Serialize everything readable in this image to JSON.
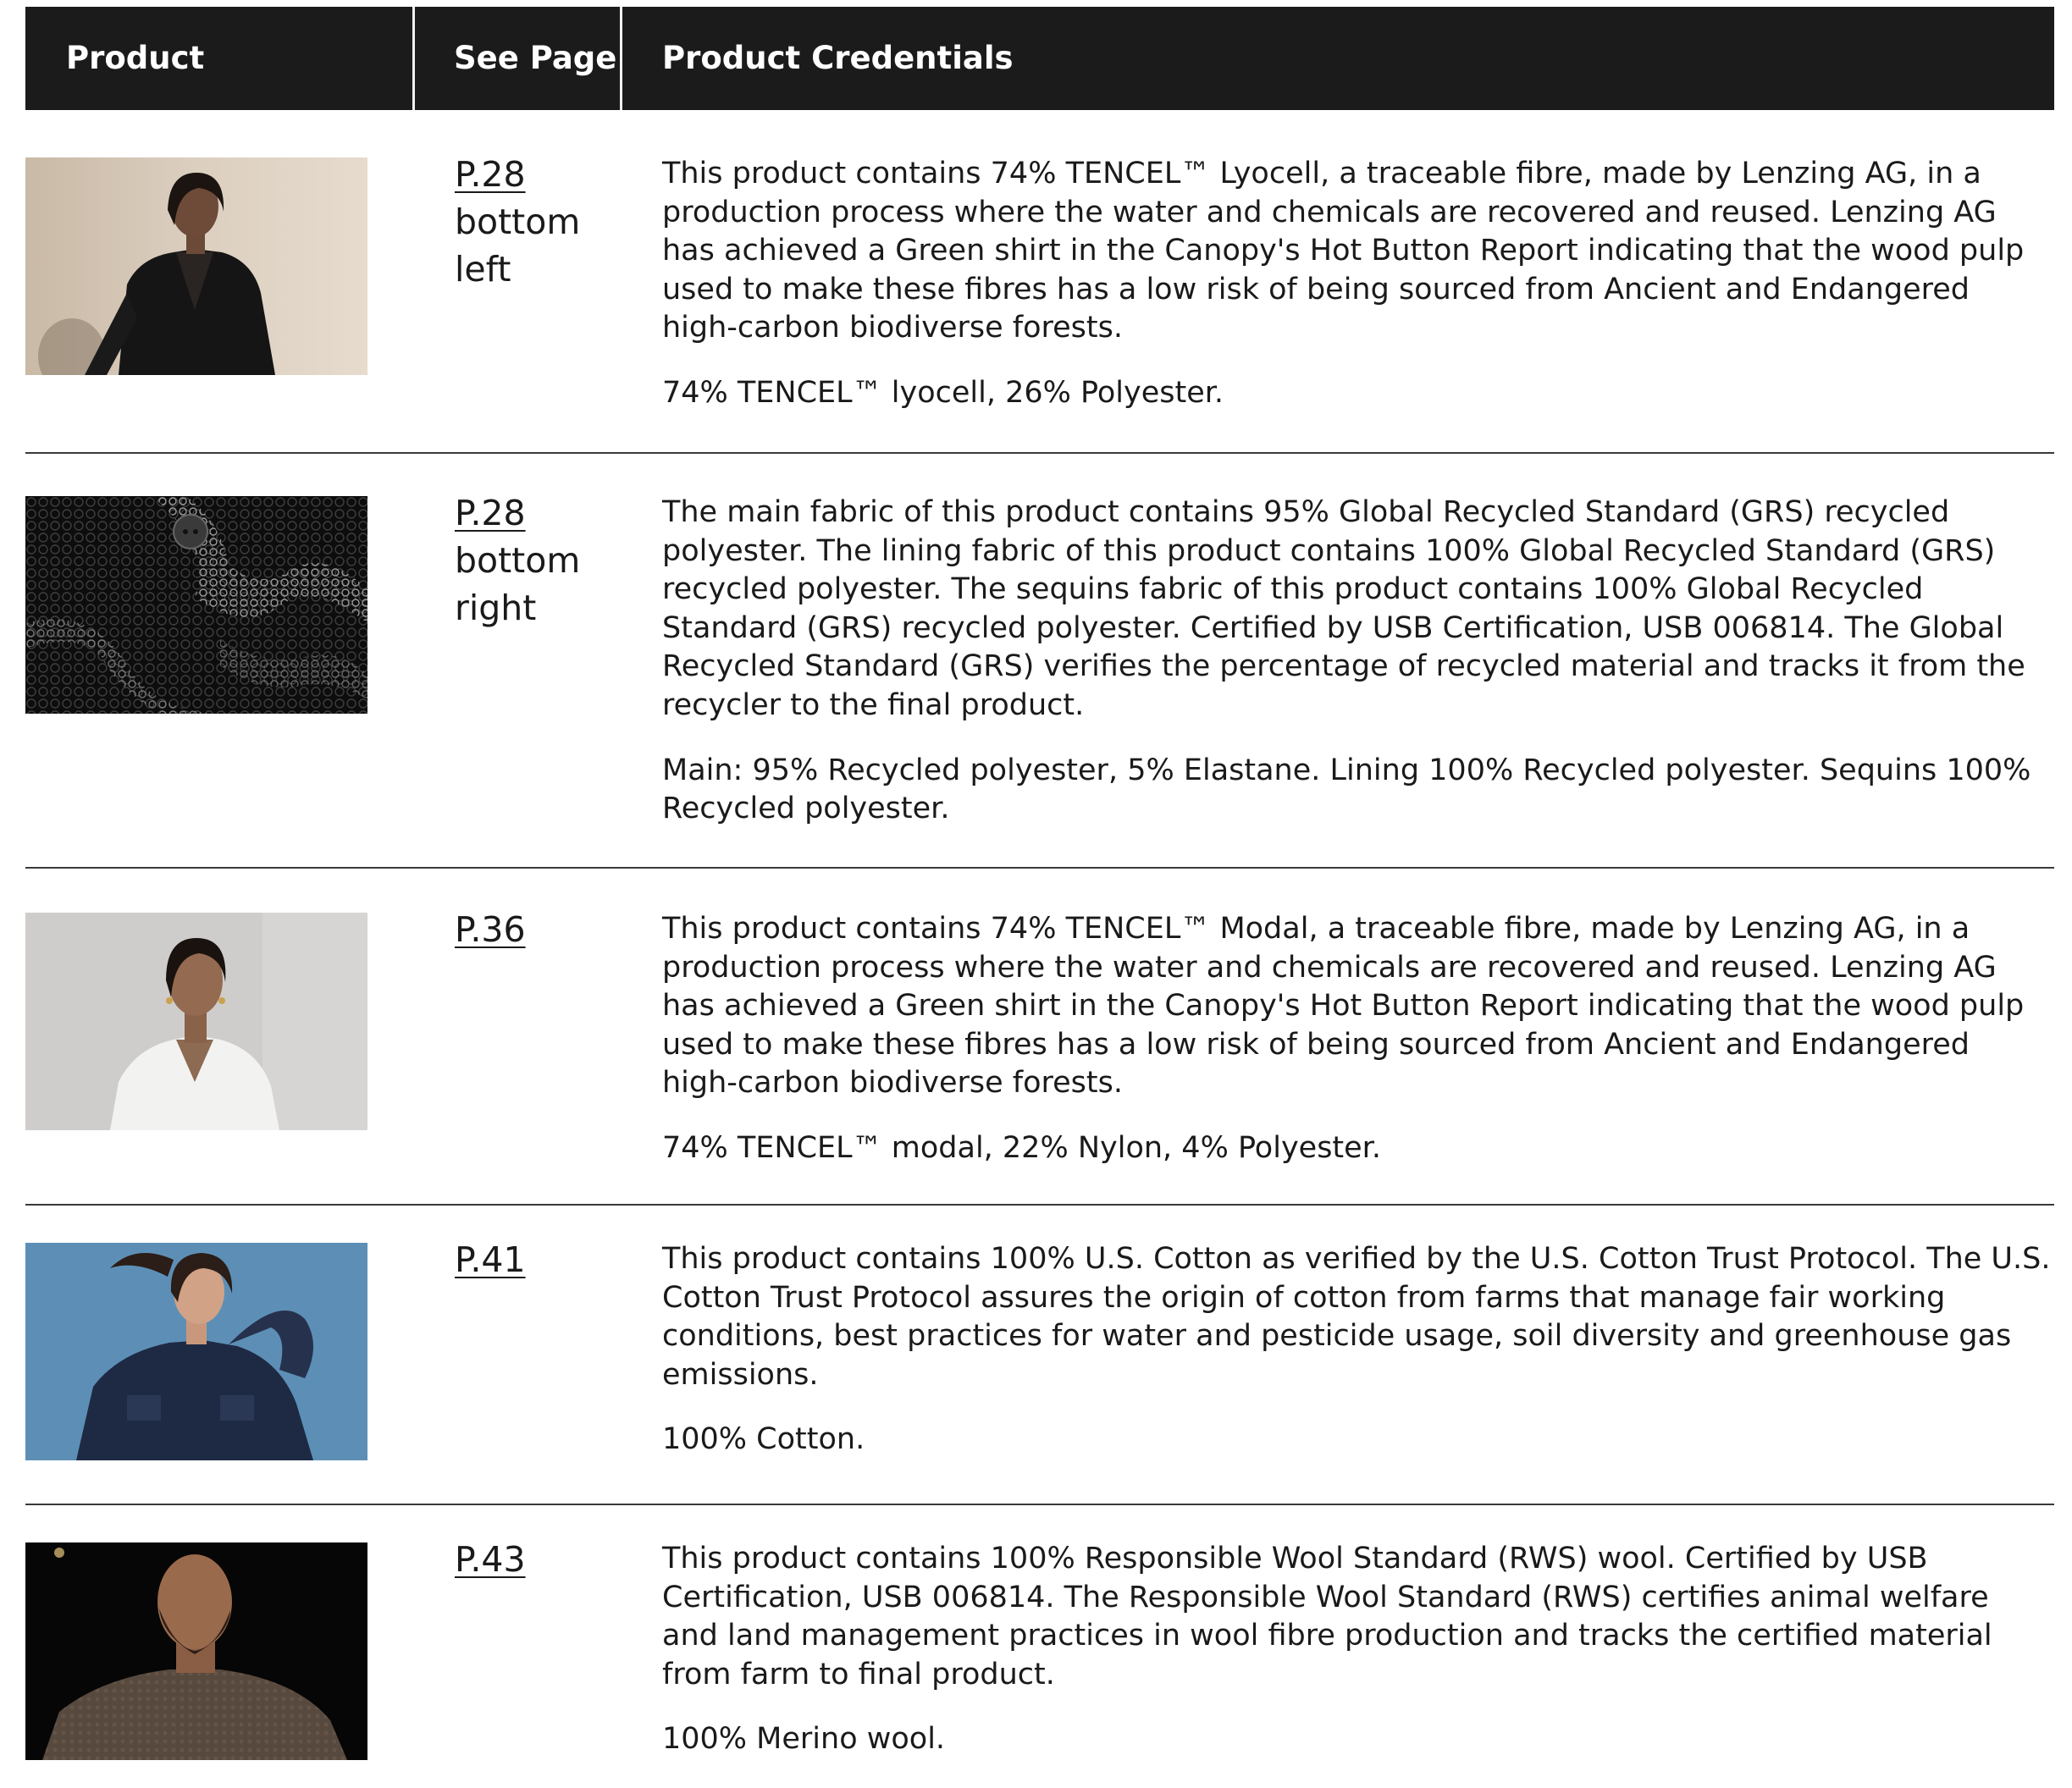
{
  "header": {
    "product": "Product",
    "see_page": "See Page",
    "credentials": "Product Credentials"
  },
  "rows": [
    {
      "page": "P.28",
      "location": "bottom left",
      "credential": "This product contains 74% TENCEL™ Lyocell, a traceable fibre, made by Lenzing AG, in a production process where the water and chemicals are recovered and reused. Lenzing AG has achieved a Green shirt in the Canopy's Hot Button Report indicating that the wood pulp used to make these fibres has a low risk of being sourced from Ancient and Endangered high-carbon biodiverse forests.",
      "composition": "74% TENCEL™ lyocell, 26% Polyester.",
      "image": "woman in black blazer"
    },
    {
      "page": "P.28",
      "location": "bottom right",
      "credential": "The main fabric of this product contains 95% Global Recycled Standard (GRS) recycled polyester. The lining fabric of this product contains 100% Global Recycled Standard (GRS) recycled polyester. The sequins fabric of this product contains 100% Global Recycled Standard (GRS) recycled polyester. Certified by USB Certification, USB 006814. The Global Recycled Standard (GRS) verifies the percentage of recycled material and tracks it from the recycler to the final product.",
      "composition": "Main: 95% Recycled polyester, 5% Elastane. Lining 100% Recycled polyester. Sequins 100% Recycled polyester.",
      "image": "black sequin fabric close-up"
    },
    {
      "page": "P.36",
      "location": "",
      "credential": "This product contains 74% TENCEL™ Modal, a traceable fibre, made by Lenzing AG, in a production process where the water and chemicals are recovered and reused. Lenzing AG has achieved a Green shirt in the Canopy's Hot Button Report indicating that the wood pulp used to make these fibres has a low risk of being sourced from Ancient and Endangered high-carbon biodiverse forests.",
      "composition": "74% TENCEL™ modal, 22% Nylon, 4% Polyester.",
      "image": "woman in white shirt"
    },
    {
      "page": "P.41",
      "location": "",
      "credential": "This product contains 100% U.S. Cotton as verified by the U.S. Cotton Trust Protocol. The U.S. Cotton Trust Protocol assures the origin of cotton from farms that manage fair working conditions, best practices for water and pesticide usage, soil diversity and greenhouse gas emissions.",
      "composition": "100% Cotton.",
      "image": "woman in denim shirt on blue background"
    },
    {
      "page": "P.43",
      "location": "",
      "credential": "This product contains 100% Responsible Wool Standard (RWS) wool. Certified by USB Certification, USB 006814. The Responsible Wool Standard (RWS) certifies animal welfare and land management practices in wool fibre production and tracks the certified material from farm to final product.",
      "composition": "100% Merino wool.",
      "image": "man in brown knit sweater"
    }
  ]
}
